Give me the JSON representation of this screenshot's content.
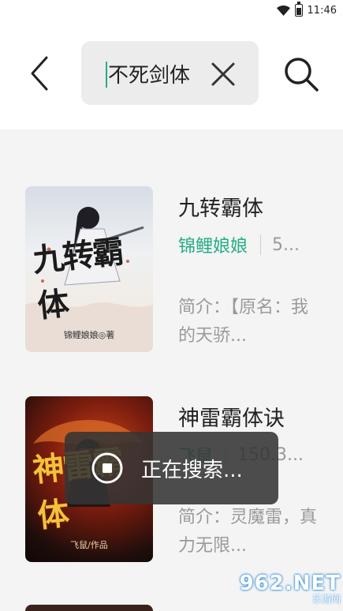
{
  "status_bar": {
    "time": "11:46"
  },
  "search": {
    "query": "不死剑体"
  },
  "results": [
    {
      "title": "九转霸体",
      "author": "锦鲤娘娘",
      "wordcount": "5...",
      "intro": "简介：【原名：我的天骄...",
      "cover_title": "九转霸体",
      "cover_author": "锦鲤娘娘◎著"
    },
    {
      "title": "神雷霸体诀",
      "author": "飞鼠",
      "wordcount": "150.3...",
      "intro": "简介：灵魔雷，真力无限...",
      "cover_title": "神雷霸体",
      "cover_author": "飞鼠/作品"
    }
  ],
  "toast": {
    "text": "正在搜索..."
  },
  "watermark": {
    "logo": "962.NET",
    "sub": "乐游网"
  },
  "colors": {
    "accent": "#24ad87",
    "toast_bg": "#343434"
  }
}
